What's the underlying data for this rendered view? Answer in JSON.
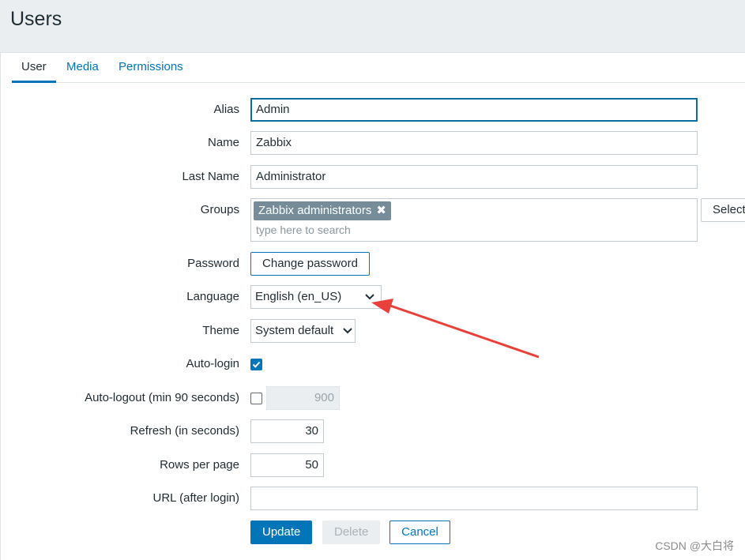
{
  "page": {
    "title": "Users"
  },
  "tabs": [
    {
      "label": "User",
      "active": true
    },
    {
      "label": "Media",
      "active": false
    },
    {
      "label": "Permissions",
      "active": false
    }
  ],
  "form": {
    "alias": {
      "label": "Alias",
      "value": "Admin"
    },
    "name": {
      "label": "Name",
      "value": "Zabbix"
    },
    "last_name": {
      "label": "Last Name",
      "value": "Administrator"
    },
    "groups": {
      "label": "Groups",
      "chip": "Zabbix administrators",
      "placeholder": "type here to search",
      "select_label": "Select"
    },
    "password": {
      "label": "Password",
      "button": "Change password"
    },
    "language": {
      "label": "Language",
      "value": "English (en_US)"
    },
    "theme": {
      "label": "Theme",
      "value": "System default"
    },
    "autologin": {
      "label": "Auto-login",
      "checked": true
    },
    "autologout": {
      "label": "Auto-logout (min 90 seconds)",
      "checked": false,
      "value": "900"
    },
    "refresh": {
      "label": "Refresh (in seconds)",
      "value": "30"
    },
    "rows": {
      "label": "Rows per page",
      "value": "50"
    },
    "url": {
      "label": "URL (after login)",
      "value": ""
    }
  },
  "actions": {
    "update": "Update",
    "delete": "Delete",
    "cancel": "Cancel"
  },
  "annotation": {
    "color": "#e8413c"
  },
  "watermark": "CSDN @大白将",
  "colors": {
    "accent": "#0275b8",
    "chip": "#768d99",
    "background": "#ebeef0"
  }
}
